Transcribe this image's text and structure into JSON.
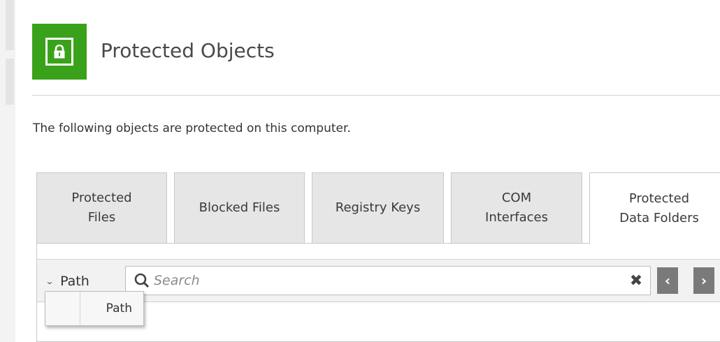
{
  "header": {
    "title": "Protected Objects",
    "icon": "lock-icon",
    "icon_bg": "#3aa21a"
  },
  "intro_text": "The following objects are protected on this computer.",
  "tabs": [
    {
      "label": "Protected\nFiles",
      "active": false
    },
    {
      "label": "Blocked Files",
      "active": false
    },
    {
      "label": "Registry Keys",
      "active": false
    },
    {
      "label": "COM\nInterfaces",
      "active": false
    },
    {
      "label": "Protected\nData Folders",
      "active": true
    }
  ],
  "toolbar": {
    "column_selector_label": "Path",
    "search_placeholder": "Search",
    "search_value": "",
    "clear_icon": "close-icon",
    "prev_icon": "chevron-left-icon",
    "next_icon": "chevron-right-icon"
  },
  "column_dropdown": {
    "options": [
      {
        "label": "Path"
      }
    ]
  }
}
